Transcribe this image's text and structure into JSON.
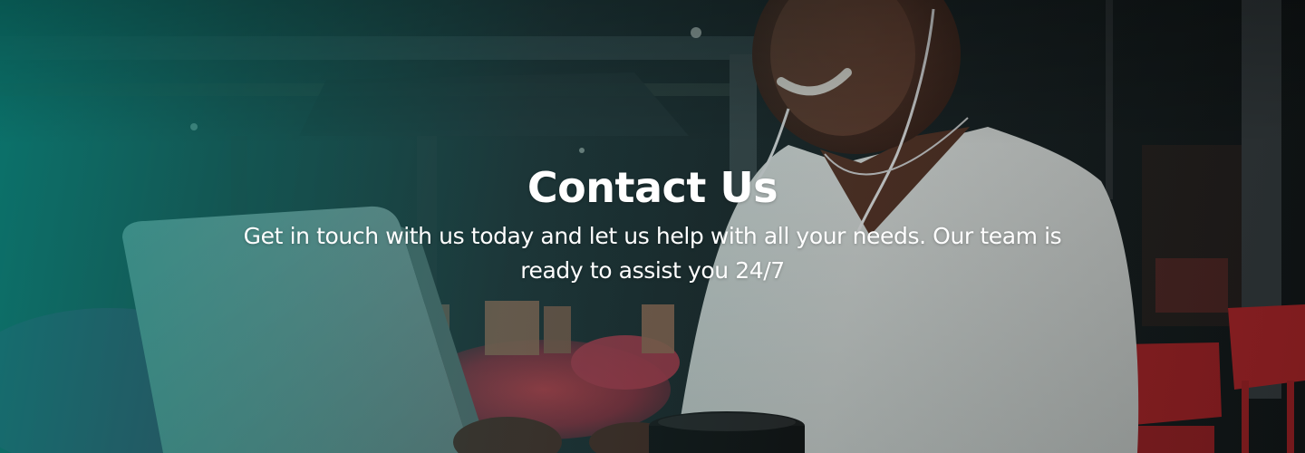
{
  "hero": {
    "title": "Contact Us",
    "subtitle": "Get in touch with us today and let us help with all your needs. Our team is ready to assist you 24/7",
    "overlay_color": "#008076",
    "text_color": "#ffffff"
  },
  "background_image": {
    "subject": "smiling-woman-with-earphones-and-laptop-at-outdoor-cafe"
  }
}
